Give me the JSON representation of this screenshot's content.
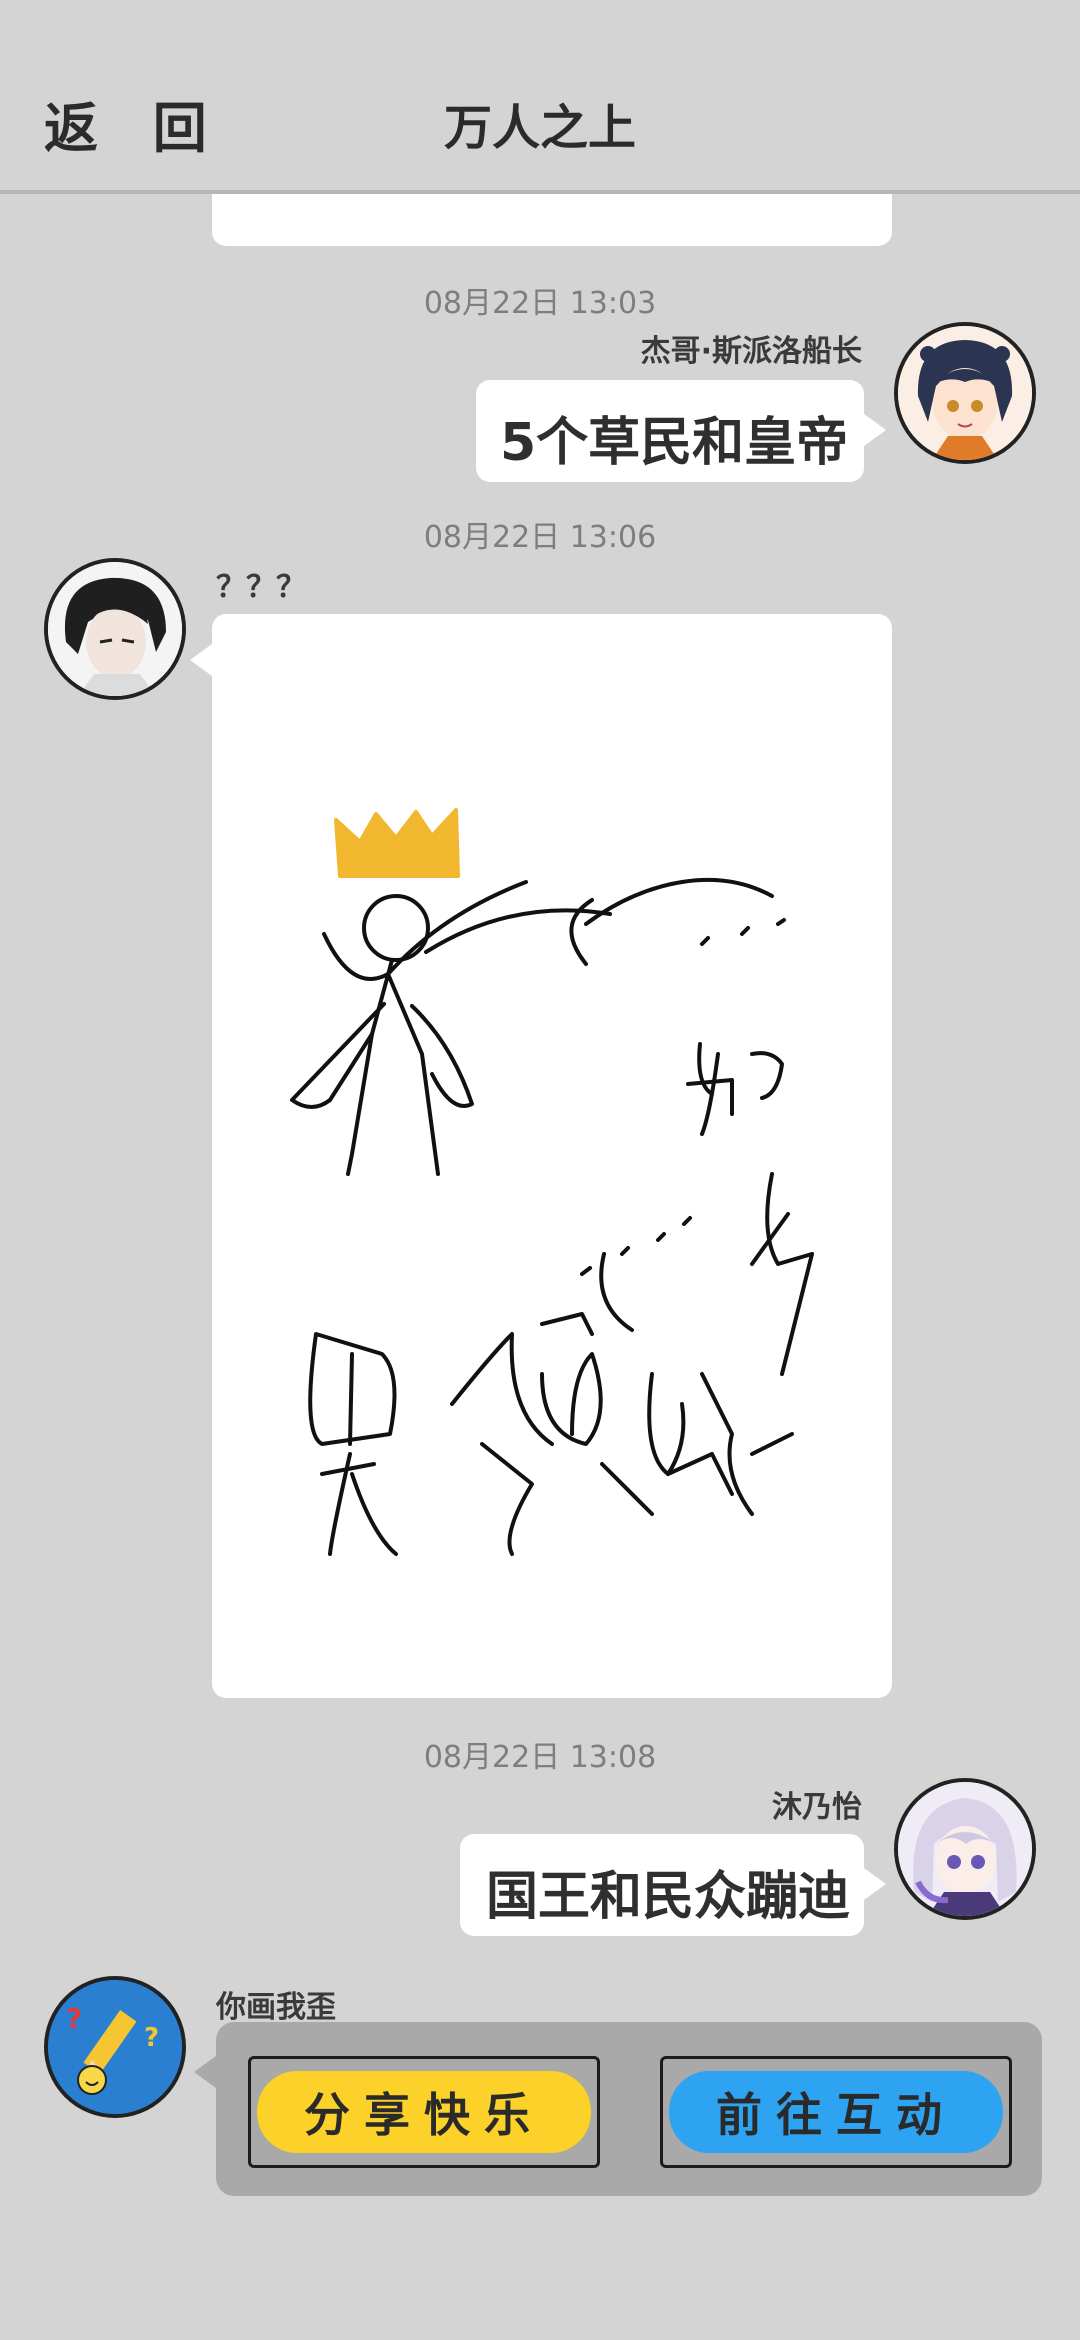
{
  "header": {
    "back_label": "返 回",
    "title": "万人之上"
  },
  "messages": [
    {
      "time": "08月22日 13:03",
      "sender": "杰哥·斯派洛船长",
      "text": "5个草民和皇帝"
    },
    {
      "time": "08月22日 13:06",
      "sender": "？？？"
    },
    {
      "time": "08月22日 13:08",
      "sender": "沐乃怡",
      "text": "国王和民众蹦迪"
    }
  ],
  "game_card": {
    "sender": "你画我歪",
    "share_label": "分享快乐",
    "go_label": "前往互动",
    "share_color": "#fbd12a",
    "go_color": "#2ea3f2"
  }
}
